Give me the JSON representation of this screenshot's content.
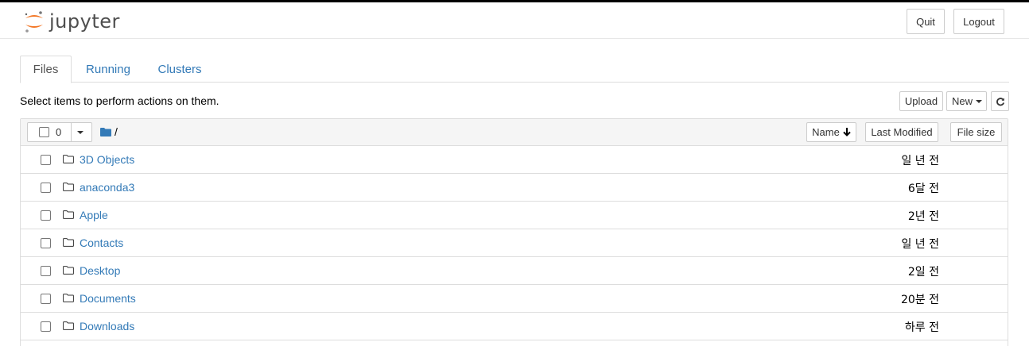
{
  "app": {
    "logo_text": "jupyter"
  },
  "header": {
    "quit_label": "Quit",
    "logout_label": "Logout"
  },
  "tabs": [
    {
      "label": "Files"
    },
    {
      "label": "Running"
    },
    {
      "label": "Clusters"
    }
  ],
  "toolbar": {
    "instructions": "Select items to perform actions on them.",
    "upload_label": "Upload",
    "new_label": "New"
  },
  "list_header": {
    "selected_count": "0",
    "breadcrumb": "/",
    "sort_name_label": "Name",
    "last_modified_label": "Last Modified",
    "file_size_label": "File size"
  },
  "files": [
    {
      "name": "3D Objects",
      "modified": "일 년 전"
    },
    {
      "name": "anaconda3",
      "modified": "6달 전"
    },
    {
      "name": "Apple",
      "modified": "2년 전"
    },
    {
      "name": "Contacts",
      "modified": "일 년 전"
    },
    {
      "name": "Desktop",
      "modified": "2일 전"
    },
    {
      "name": "Documents",
      "modified": "20분 전"
    },
    {
      "name": "Downloads",
      "modified": "하루 전"
    }
  ],
  "colors": {
    "link": "#337ab7",
    "logo_orange": "#f37726",
    "header_bg": "#f5f5f5"
  }
}
